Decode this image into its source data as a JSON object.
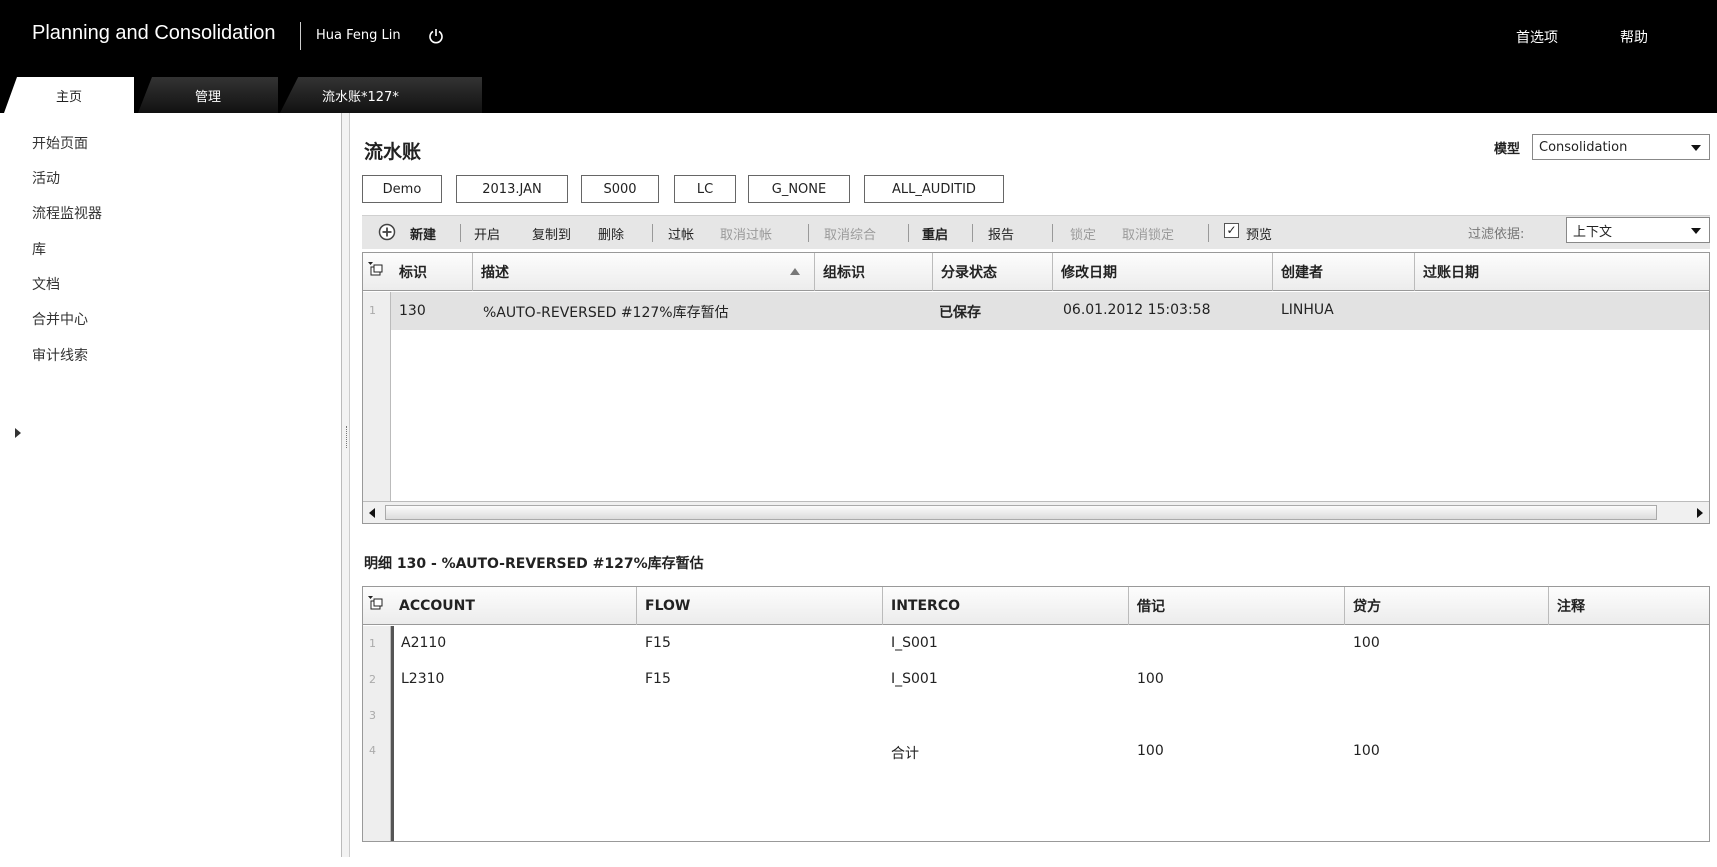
{
  "header": {
    "app_title": "Planning and Consolidation",
    "user": "Hua Feng Lin",
    "preferences": "首选项",
    "help": "帮助",
    "tabs": [
      {
        "label": "主页"
      },
      {
        "label": "管理"
      },
      {
        "label": "流水账*127*"
      }
    ]
  },
  "nav": {
    "items": [
      {
        "label": "开始页面"
      },
      {
        "label": "活动"
      },
      {
        "label": "流程监视器"
      },
      {
        "label": "库"
      },
      {
        "label": "文档"
      },
      {
        "label": "合并中心"
      },
      {
        "label": "审计线索"
      }
    ]
  },
  "main": {
    "title": "流水账",
    "model_label": "模型",
    "model_value": "Consolidation",
    "context": [
      "Demo",
      "2013.JAN",
      "S000",
      "LC",
      "G_NONE",
      "ALL_AUDITID"
    ]
  },
  "toolbar": {
    "new": "新建",
    "open": "开启",
    "copy_to": "复制到",
    "delete": "删除",
    "post": "过帐",
    "unpost": "取消过帐",
    "unconsolidate": "取消综合",
    "reopen": "重启",
    "report": "报告",
    "lock": "锁定",
    "unlock": "取消锁定",
    "preview": "预览",
    "preview_checked": "✓",
    "filter_label": "过滤依据:",
    "filter_value": "上下文"
  },
  "journal_grid": {
    "columns": [
      "标识",
      "描述",
      "组标识",
      "分录状态",
      "修改日期",
      "创建者",
      "过账日期"
    ],
    "rows": [
      {
        "num": "1",
        "id": "130",
        "desc": "%AUTO-REVERSED #127%库存暂估",
        "group": "",
        "status": "已保存",
        "modified": "06.01.2012 15:03:58",
        "creator": "LINHUA",
        "posted": ""
      }
    ]
  },
  "detail": {
    "title": "明细 130 - %AUTO-REVERSED #127%库存暂估",
    "columns": [
      "ACCOUNT",
      "FLOW",
      "INTERCO",
      "借记",
      "贷方",
      "注释"
    ],
    "rows": [
      {
        "num": "1",
        "account": "A2110",
        "flow": "F15",
        "interco": "I_S001",
        "debit": "",
        "credit": "100",
        "note": ""
      },
      {
        "num": "2",
        "account": "L2310",
        "flow": "F15",
        "interco": "I_S001",
        "debit": "100",
        "credit": "",
        "note": ""
      },
      {
        "num": "3",
        "account": "",
        "flow": "",
        "interco": "",
        "debit": "",
        "credit": "",
        "note": ""
      },
      {
        "num": "4",
        "account": "",
        "flow": "",
        "interco": "合计",
        "debit": "100",
        "credit": "100",
        "note": ""
      }
    ]
  }
}
